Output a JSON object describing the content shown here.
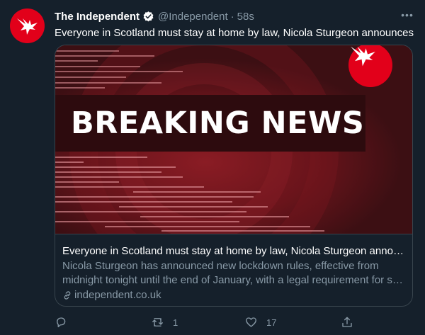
{
  "tweet": {
    "author_name": "The Independent",
    "handle": "@Independent",
    "separator": "·",
    "time": "58s",
    "more_label": "•••",
    "text": "Everyone in Scotland must stay at home by law, Nicola Sturgeon announces",
    "icons": {
      "avatar": "independent-eagle-logo",
      "verified": "verified-badge-icon",
      "more": "more-options-icon"
    }
  },
  "card": {
    "image_headline": "BREAKING NEWS",
    "title": "Everyone in Scotland must stay at home by law, Nicola Sturgeon announces",
    "description_line1": "Nicola Sturgeon has announced new lockdown rules, effective from",
    "description_line2": "midnight tonight until the end of January, with a legal requirement for staying at home",
    "domain": "independent.co.uk",
    "link_icon": "link-icon"
  },
  "actions": {
    "reply_count": "",
    "retweet_count": "1",
    "like_count": "17",
    "icons": [
      "reply-icon",
      "retweet-icon",
      "like-icon",
      "share-icon"
    ]
  },
  "colors": {
    "background": "#15202b",
    "brand_red": "#e2001a",
    "secondary_text": "#8899a6",
    "border": "#38444d"
  }
}
